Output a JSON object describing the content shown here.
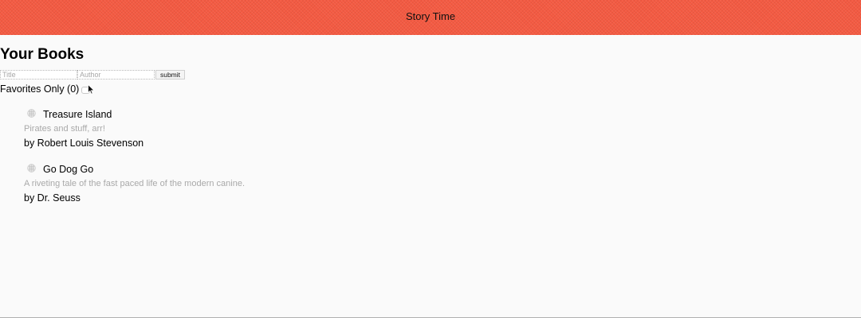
{
  "header": {
    "title": "Story Time"
  },
  "main": {
    "title": "Your Books",
    "form": {
      "title_placeholder": "Title",
      "author_placeholder": "Author",
      "submit_label": "submit"
    },
    "favorites": {
      "label": "Favorites Only (0)",
      "checked": false
    },
    "books": [
      {
        "title": "Treasure Island",
        "description": "Pirates and stuff, arr!",
        "author": "by Robert Louis Stevenson"
      },
      {
        "title": "Go Dog Go",
        "description": "A riveting tale of the fast paced life of the modern canine.",
        "author": "by Dr. Seuss"
      }
    ]
  },
  "colors": {
    "header_bg": "#f45a42",
    "page_bg": "#fafafa",
    "description_text": "#a9a9a9"
  },
  "icons": {
    "favorite_toggle": "grid-star-icon",
    "cursor": "mouse-pointer-icon"
  }
}
